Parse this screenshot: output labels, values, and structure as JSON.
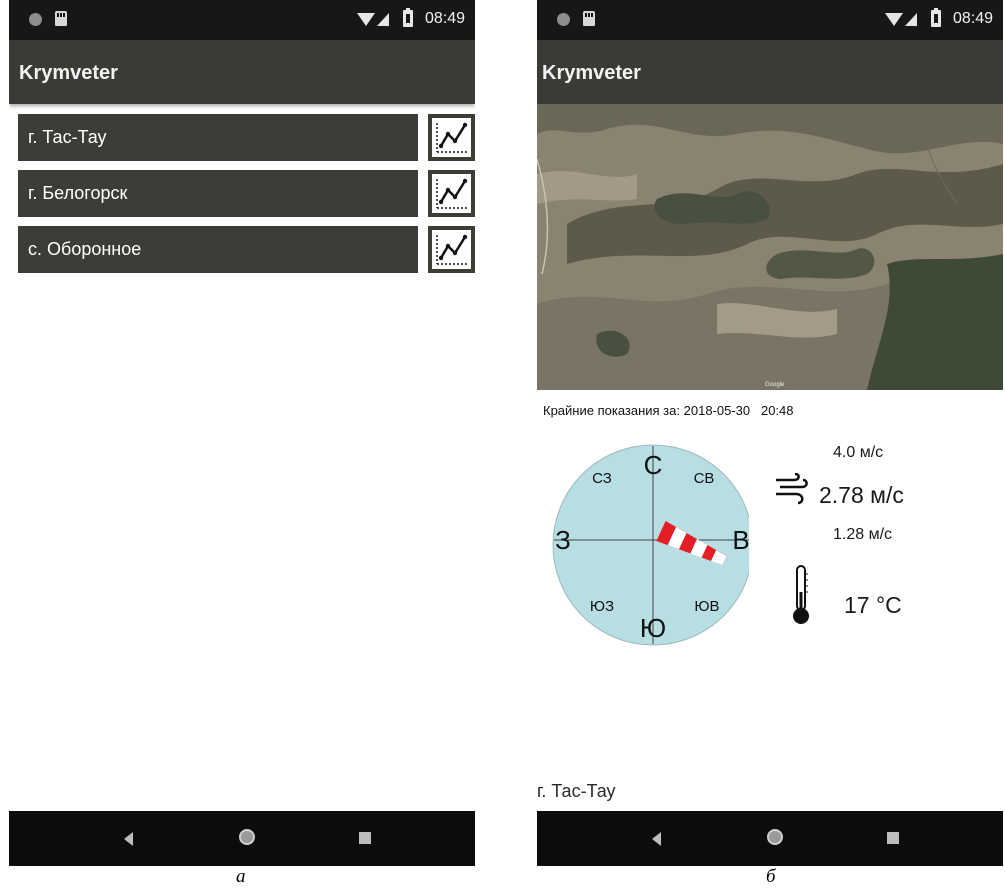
{
  "colors": {
    "appbar": "#3a3a36",
    "statusbar": "#171717",
    "list_item": "#3d3c37",
    "compass_fill": "#b6dee3",
    "windsock_red": "#e41e26"
  },
  "status_bar": {
    "time": "08:49",
    "icons": [
      "notification-dot-icon",
      "sd-card-icon",
      "wifi-icon",
      "cell-signal-icon",
      "battery-icon"
    ]
  },
  "screen_a": {
    "app_title": "Krymveter",
    "locations": [
      {
        "name": "г. Тас-Тау",
        "chart_icon": "line-chart-icon"
      },
      {
        "name": "г. Белогорск",
        "chart_icon": "line-chart-icon"
      },
      {
        "name": "с. Оборонное",
        "chart_icon": "line-chart-icon"
      }
    ]
  },
  "screen_b": {
    "app_title": "Krymveter",
    "map": {
      "type": "satellite",
      "credit": "Google"
    },
    "reading": {
      "label": "Крайние показания за:",
      "date": "2018-05-30",
      "time": "20:48"
    },
    "compass": {
      "N": "С",
      "NE": "СВ",
      "E": "В",
      "SE": "ЮВ",
      "S": "Ю",
      "SW": "ЮЗ",
      "W": "З",
      "NW": "СЗ",
      "windsock_bearing_deg": 115
    },
    "wind": {
      "max": "4.0 м/с",
      "avg": "2.78 м/с",
      "min": "1.28 м/с",
      "icon": "wind-icon"
    },
    "temperature": {
      "value": "17 °C",
      "icon": "thermometer-icon"
    },
    "station_name": "г. Тас-Тау"
  },
  "nav_bar": {
    "icons": [
      "back-icon",
      "home-icon",
      "recent-apps-icon"
    ]
  },
  "captions": {
    "a": "а",
    "b": "б"
  }
}
